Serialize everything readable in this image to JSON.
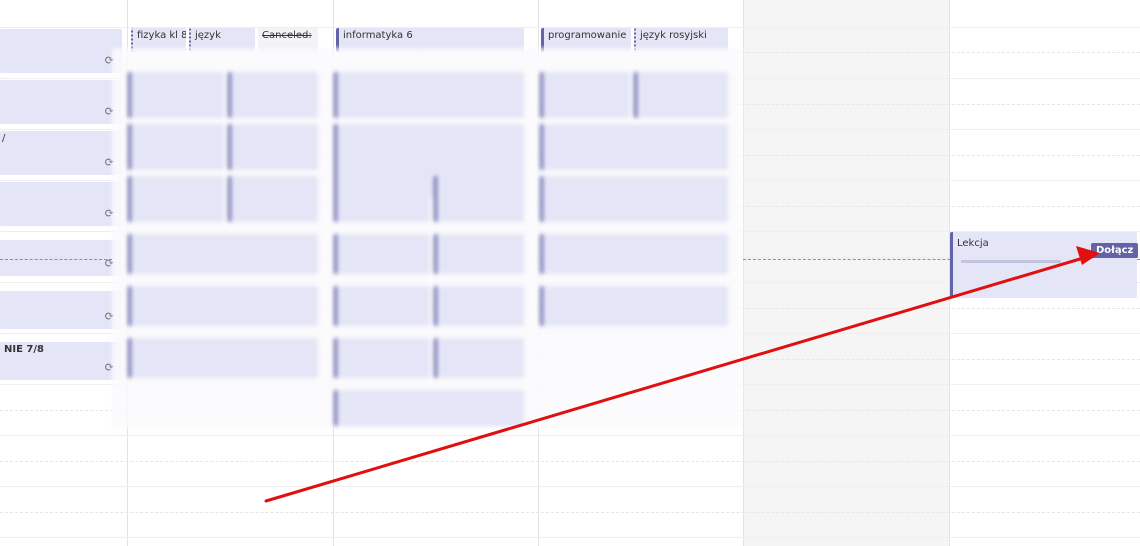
{
  "left_events": [
    {
      "title": ""
    },
    {
      "title": ""
    },
    {
      "title": ""
    },
    {
      "title": ""
    },
    {
      "title": ""
    },
    {
      "title": ""
    },
    {
      "title": "NIE 7/8"
    }
  ],
  "top_events": {
    "fizyka": "fizyka kl 8",
    "jezyk": "język",
    "canceled": "Canceled:",
    "informatyka": "informatyka 6",
    "programowanie": "programowanie",
    "jezyk_rosyjski": "język rosyjski"
  },
  "lekcja_card": {
    "title": "Lekcja",
    "join_label": "Dołącz"
  },
  "icons": {
    "sync": "sync-icon",
    "arrow": "red-arrow-annotation"
  },
  "colors": {
    "accent": "#6264a7",
    "event_bg": "#e4e5f6",
    "current_time": "#e1705a",
    "annotation": "#e01010"
  }
}
